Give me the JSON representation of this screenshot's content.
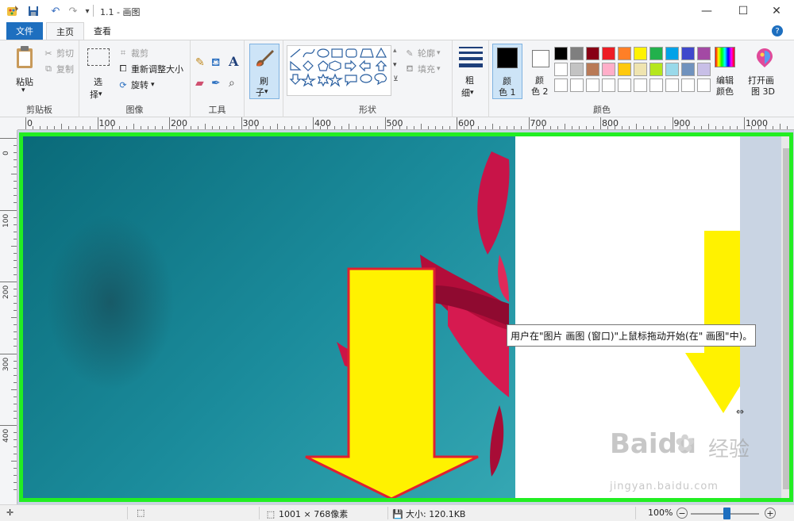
{
  "titlebar": {
    "title": "1.1 - 画图",
    "quick_access_more": "▾",
    "minimize": "—",
    "maximize": "☐",
    "close": "✕"
  },
  "tabs": [
    {
      "label": "文件"
    },
    {
      "label": "主页"
    },
    {
      "label": "查看"
    }
  ],
  "help": "?",
  "ribbon": {
    "clipboard": {
      "paste": "粘贴",
      "cut": "剪切",
      "copy": "复制",
      "group": "剪贴板"
    },
    "image": {
      "select_line1": "选",
      "select_line2": "择",
      "crop": "裁剪",
      "resize": "重新调整大小",
      "rotate": "旋转",
      "group": "图像"
    },
    "tools": {
      "group": "工具",
      "text_glyph": "A"
    },
    "brushes": {
      "line1": "刷",
      "line2": "子"
    },
    "shapes": {
      "outline": "轮廓",
      "fill": "填充",
      "group": "形状"
    },
    "size": {
      "line1": "粗",
      "line2": "细"
    },
    "colors": {
      "color1_line1": "颜",
      "color1_line2": "色 1",
      "color2_line1": "颜",
      "color2_line2": "色 2",
      "edit_line1": "编辑",
      "edit_line2": "颜色",
      "paint3d_line1": "打开画",
      "paint3d_line2": "图 3D",
      "group": "颜色",
      "color1_value": "#000000",
      "color2_value": "#ffffff",
      "palette_row1": [
        "#000000",
        "#7f7f7f",
        "#880015",
        "#ed1c24",
        "#ff7f27",
        "#fff200",
        "#22b14c",
        "#00a2e8",
        "#3f48cc",
        "#a349a4"
      ],
      "palette_row2": [
        "#ffffff",
        "#c3c3c3",
        "#b97a57",
        "#ffaec9",
        "#ffc90e",
        "#efe4b0",
        "#b5e61d",
        "#99d9ea",
        "#7092be",
        "#c8bfe7"
      ]
    }
  },
  "ruler": {
    "h_labels": [
      "0",
      "100",
      "200",
      "300",
      "400",
      "500",
      "600",
      "700",
      "800",
      "900",
      "1000"
    ],
    "v_labels": [
      "0",
      "100",
      "200",
      "300",
      "400"
    ]
  },
  "tooltip": "用户在\"图片 画图 (窗口)\"上鼠标拖动开始(在\" 画图\"中)。",
  "watermark": {
    "brand": "Baidu",
    "brand_cn": "经验",
    "url": "jingyan.baidu.com"
  },
  "status": {
    "dimensions": "1001 × 768像素",
    "size": "大小: 120.1KB",
    "zoom": "100%",
    "zoom_out": "−",
    "zoom_in": "+"
  }
}
